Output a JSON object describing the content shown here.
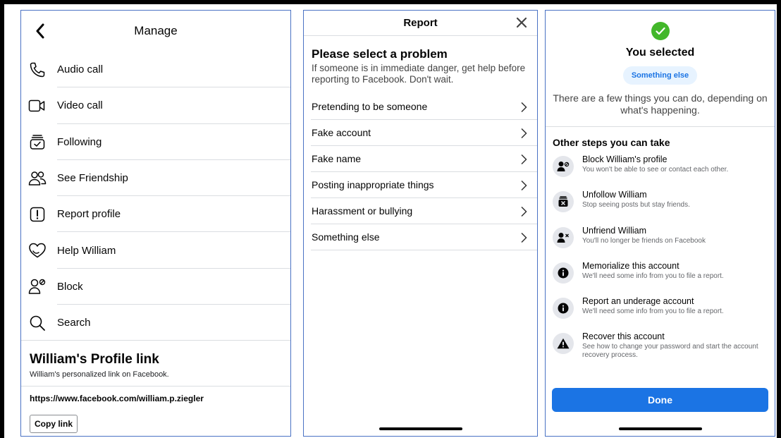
{
  "manage": {
    "title": "Manage",
    "items": [
      {
        "label": "Audio call",
        "icon": "phone-icon"
      },
      {
        "label": "Video call",
        "icon": "video-camera-icon"
      },
      {
        "label": "Following",
        "icon": "following-icon"
      },
      {
        "label": "See Friendship",
        "icon": "friends-icon"
      },
      {
        "label": "Report profile",
        "icon": "report-icon"
      },
      {
        "label": "Help William",
        "icon": "heart-icon"
      },
      {
        "label": "Block",
        "icon": "block-user-icon"
      },
      {
        "label": "Search",
        "icon": "search-icon"
      }
    ],
    "profile_link": {
      "title": "William's Profile link",
      "description": "William's personalized link on Facebook.",
      "url": "https://www.facebook.com/william.p.ziegler",
      "copy_label": "Copy link"
    }
  },
  "report": {
    "title": "Report",
    "heading": "Please select a problem",
    "subtext": "If someone is in immediate danger, get help before reporting to Facebook. Don't wait.",
    "problems": [
      "Pretending to be someone",
      "Fake account",
      "Fake name",
      "Posting inappropriate things",
      "Harassment or bullying",
      "Something else"
    ]
  },
  "selected": {
    "title": "You selected",
    "badge": "Something else",
    "description": "There are a few things you can do, depending on what's happening.",
    "steps_title": "Other steps you can take",
    "steps": [
      {
        "title": "Block William's profile",
        "desc": "You won't be able to see or contact each other.",
        "icon": "block-user-icon"
      },
      {
        "title": "Unfollow William",
        "desc": "Stop seeing posts but stay friends.",
        "icon": "unfollow-icon"
      },
      {
        "title": "Unfriend William",
        "desc": "You'll no longer be friends on Facebook",
        "icon": "unfriend-icon"
      },
      {
        "title": "Memorialize this account",
        "desc": "We'll need some info from you to file a report.",
        "icon": "info-icon"
      },
      {
        "title": "Report an underage account",
        "desc": "We'll need some info from you to file a report.",
        "icon": "info-icon"
      },
      {
        "title": "Recover this account",
        "desc": "See how to change your password and start the account recovery process.",
        "icon": "warning-icon"
      }
    ],
    "done_label": "Done"
  },
  "colors": {
    "accent": "#1b74e4",
    "success": "#42b72a",
    "panel_border": "#4a72c4"
  }
}
